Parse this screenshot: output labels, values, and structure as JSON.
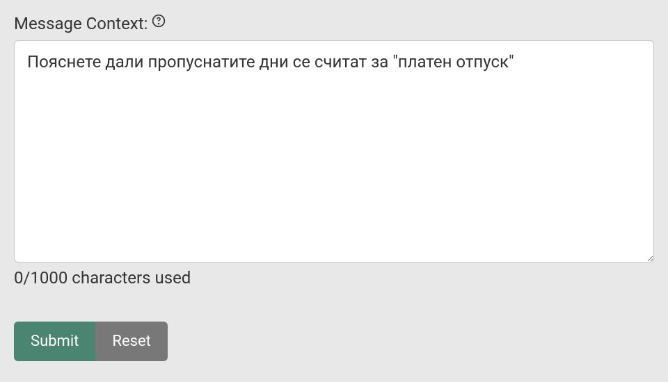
{
  "form": {
    "label": "Message Context:",
    "textarea_value": "Пояснете дали пропуснатите дни се считат за \"платен отпуск\"",
    "textarea_placeholder": "",
    "char_counter": "0/1000 characters used",
    "submit_label": "Submit",
    "reset_label": "Reset"
  }
}
